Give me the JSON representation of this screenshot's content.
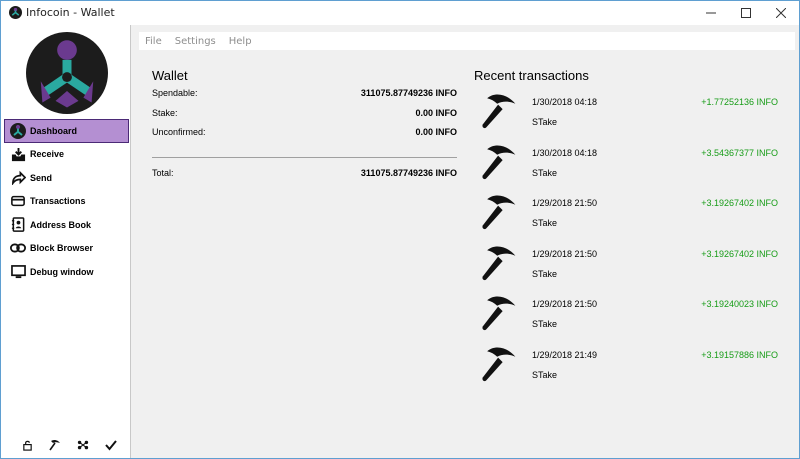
{
  "window": {
    "title": "Infocoin - Wallet",
    "controls": [
      "minimize-icon",
      "maximize-icon",
      "close-icon"
    ]
  },
  "menu": [
    "File",
    "Settings",
    "Help"
  ],
  "sidebar": {
    "items": [
      {
        "label": "Dashboard",
        "icon": "dashboard-logo-icon",
        "active": true
      },
      {
        "label": "Receive",
        "icon": "receive-inbox-icon"
      },
      {
        "label": "Send",
        "icon": "send-arrow-icon"
      },
      {
        "label": "Transactions",
        "icon": "transactions-card-icon"
      },
      {
        "label": "Address Book",
        "icon": "address-book-icon"
      },
      {
        "label": "Block Browser",
        "icon": "chain-link-icon"
      },
      {
        "label": "Debug window",
        "icon": "monitor-icon"
      }
    ],
    "status_icons": [
      "lock-icon",
      "pickaxe-icon",
      "network-icon",
      "checkmark-icon"
    ],
    "active_color": "#b48fd2"
  },
  "wallet": {
    "title": "Wallet",
    "spendable_label": "Spendable:",
    "spendable_value": "311075.87749236 INFO",
    "stake_label": "Stake:",
    "stake_value": "0.00 INFO",
    "unconfirmed_label": "Unconfirmed:",
    "unconfirmed_value": "0.00 INFO",
    "total_label": "Total:",
    "total_value": "311075.87749236 INFO"
  },
  "recent": {
    "title": "Recent transactions",
    "amount_color": "#179c17",
    "items": [
      {
        "date": "1/30/2018 04:18",
        "amount": "+1.77252136 INFO",
        "type": "STake",
        "icon": "pickaxe-icon"
      },
      {
        "date": "1/30/2018 04:18",
        "amount": "+3.54367377 INFO",
        "type": "STake",
        "icon": "pickaxe-icon"
      },
      {
        "date": "1/29/2018 21:50",
        "amount": "+3.19267402 INFO",
        "type": "STake",
        "icon": "pickaxe-icon"
      },
      {
        "date": "1/29/2018 21:50",
        "amount": "+3.19267402 INFO",
        "type": "STake",
        "icon": "pickaxe-icon"
      },
      {
        "date": "1/29/2018 21:50",
        "amount": "+3.19240023 INFO",
        "type": "STake",
        "icon": "pickaxe-icon"
      },
      {
        "date": "1/29/2018 21:49",
        "amount": "+3.19157886 INFO",
        "type": "STake",
        "icon": "pickaxe-icon"
      }
    ]
  }
}
